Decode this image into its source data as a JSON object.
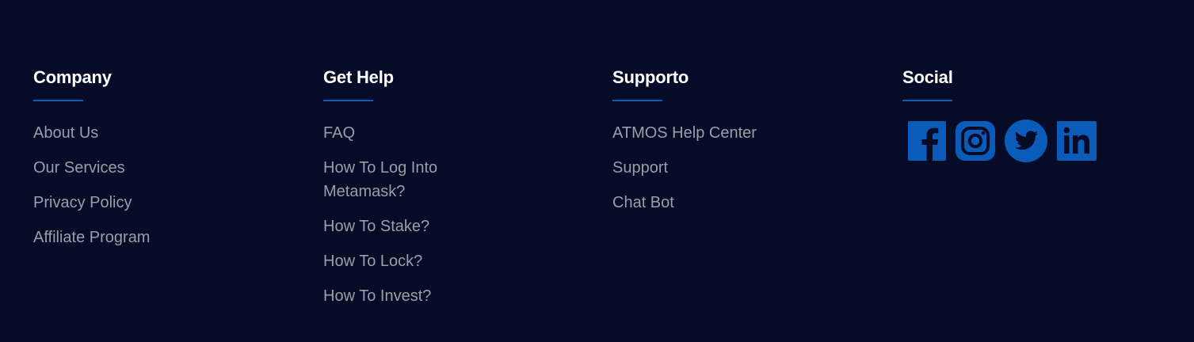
{
  "footer": {
    "company": {
      "title": "Company",
      "links": [
        "About Us",
        "Our Services",
        "Privacy Policy",
        "Affiliate Program"
      ]
    },
    "help": {
      "title": "Get Help",
      "links": [
        "FAQ",
        "How To Log Into Metamask?",
        "How To Stake?",
        "How To Lock?",
        "How To Invest?"
      ]
    },
    "support": {
      "title": "Supporto",
      "links": [
        "ATMOS Help Center",
        "Support",
        "Chat Bot"
      ]
    },
    "social": {
      "title": "Social",
      "icons": [
        "facebook-icon",
        "instagram-icon",
        "twitter-icon",
        "linkedin-icon"
      ]
    }
  },
  "colors": {
    "background": "#060c28",
    "heading": "#ffffff",
    "link": "#9a9ea8",
    "accent": "#0a5cb8"
  }
}
